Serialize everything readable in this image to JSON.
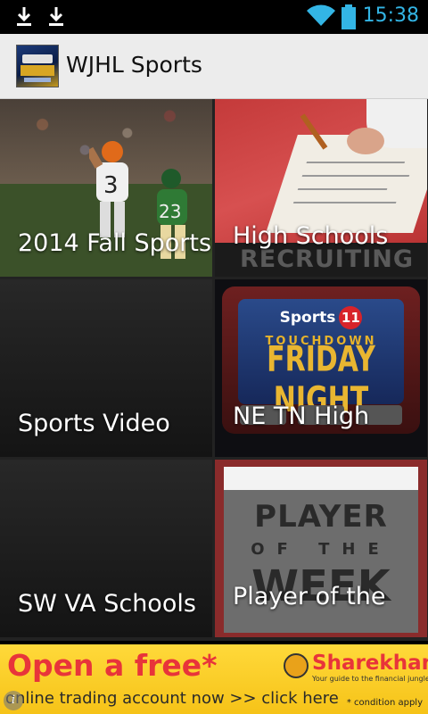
{
  "status_bar": {
    "time": "15:38",
    "icons": [
      "download-icon",
      "download-icon",
      "wifi-icon",
      "battery-icon"
    ]
  },
  "action_bar": {
    "title": "WJHL Sports",
    "logo_icon": "app-logo-icon"
  },
  "tiles": [
    {
      "label": "2014 Fall Sports"
    },
    {
      "label": "High Schools",
      "image_text": "RECRUITING"
    },
    {
      "label": "Sports Video"
    },
    {
      "label": "NE TN High",
      "image_text": {
        "brand": "Sports",
        "channel": "11",
        "line1": "TOUCHDOWN",
        "line2": "FRIDAY NIGHT"
      }
    },
    {
      "label": "SW VA Schools"
    },
    {
      "label": "Player of the",
      "image_text": {
        "line1": "PLAYER",
        "line2": "OF THE",
        "line3": "WEEK"
      }
    }
  ],
  "ad": {
    "headline": "Open a free*",
    "subline": "online trading account now >> click here",
    "brand": "Sharekhan",
    "tagline": "Your guide to the financial jungle",
    "condition": "* condition apply",
    "info_glyph": "i"
  },
  "colors": {
    "status_accent": "#33b5e5",
    "action_bar_bg": "#ececec",
    "ad_bg": "#f6c318",
    "ad_red": "#e8343a"
  }
}
